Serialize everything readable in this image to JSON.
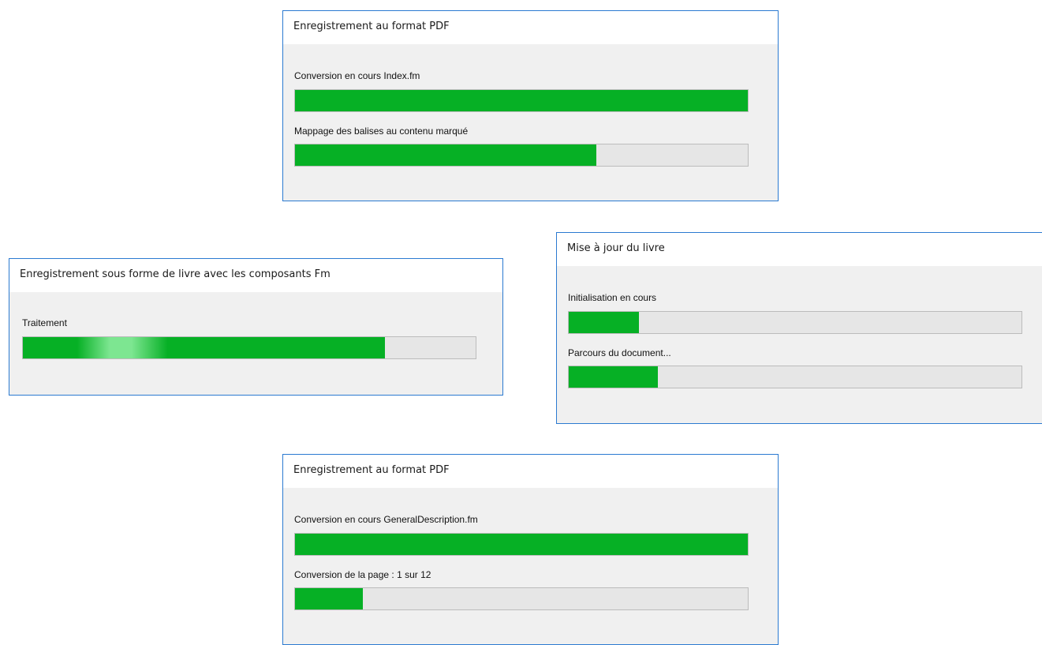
{
  "dialogs": [
    {
      "title": "Enregistrement au format PDF",
      "tasks": [
        {
          "label": "Conversion en cours Index.fm",
          "progress": 1.0
        },
        {
          "label": "Mappage des balises au contenu marqué",
          "progress": 0.665
        }
      ]
    },
    {
      "title": "Enregistrement sous forme de livre avec les composants Fm",
      "tasks": [
        {
          "label": "Traitement",
          "progress": 0.8
        }
      ]
    },
    {
      "title": "Mise à jour du livre",
      "tasks": [
        {
          "label": "Initialisation en cours",
          "progress": 0.155
        },
        {
          "label": "Parcours du document...",
          "progress": 0.197
        }
      ]
    },
    {
      "title": "Enregistrement au format PDF",
      "tasks": [
        {
          "label": "Conversion en cours GeneralDescription.fm",
          "progress": 1.0
        },
        {
          "label": "Conversion de la page : 1 sur 12",
          "progress": 0.15
        }
      ]
    }
  ],
  "colors": {
    "accent_border": "#2b7ad1",
    "progress_fill": "#06b025",
    "progress_track": "#e6e6e6",
    "dialog_body": "#f0f0f0"
  }
}
